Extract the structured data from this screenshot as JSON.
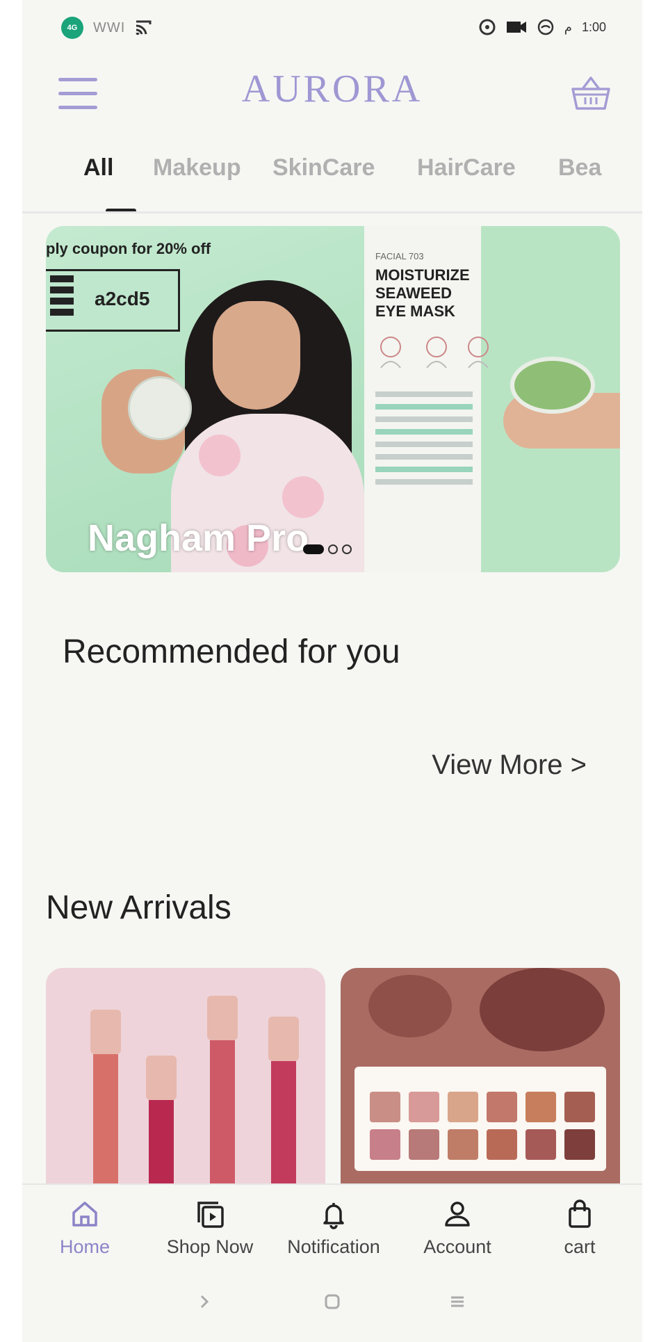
{
  "status_bar": {
    "badge_text": "4G",
    "signal_text": "WWI",
    "time": "1:00",
    "period": "م"
  },
  "header": {
    "brand": "AURORA"
  },
  "tabs": [
    "All",
    "Makeup",
    "SkinCare",
    "HairCare",
    "Bea"
  ],
  "active_tab": "All",
  "banner": {
    "coupon_text": "ply coupon for 20% off",
    "coupon_code": "a2cd5",
    "caption": "Nagham Pro",
    "product_small": "FACIAL 703",
    "product_title_1": "MOISTURIZE",
    "product_title_2": "SEAWEED",
    "product_title_3": "EYE MASK",
    "slide_index": 1,
    "slide_count": 3
  },
  "recommended": {
    "title": "Recommended for you",
    "view_more": "View More >"
  },
  "new_arrivals": {
    "title": "New Arrivals"
  },
  "bottom_nav": [
    {
      "label": "Home",
      "icon": "home-icon"
    },
    {
      "label": "Shop Now",
      "icon": "shop-now-icon"
    },
    {
      "label": "Notification",
      "icon": "bell-icon"
    },
    {
      "label": "Account",
      "icon": "account-icon"
    },
    {
      "label": "cart",
      "icon": "bag-icon"
    }
  ],
  "colors": {
    "brand": "#9f97d3",
    "active_nav": "#8c84c8",
    "background": "#f6f7f3",
    "banner_green": "#bfe6cb"
  }
}
